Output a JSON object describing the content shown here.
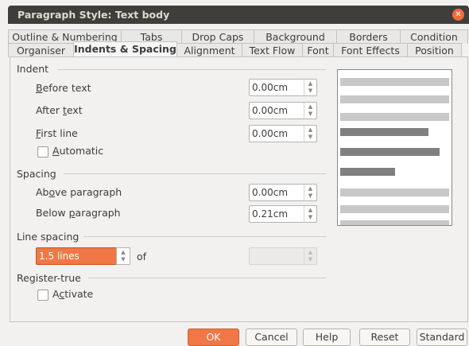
{
  "window": {
    "title": "Paragraph Style: Text body"
  },
  "tabs_row1": [
    "Outline & Numbering",
    "Tabs",
    "Drop Caps",
    "Background",
    "Borders",
    "Condition"
  ],
  "tabs_row2": [
    "Organiser",
    "Indents & Spacing",
    "Alignment",
    "Text Flow",
    "Font",
    "Font Effects",
    "Position"
  ],
  "active_tab": "Indents & Spacing",
  "indent": {
    "label": "Indent",
    "before_text": {
      "pre": "",
      "mnemonic": "B",
      "post": "efore text",
      "value": "0.00cm"
    },
    "after_text": {
      "pre": "After ",
      "mnemonic": "t",
      "post": "ext",
      "value": "0.00cm"
    },
    "first_line": {
      "pre": "",
      "mnemonic": "F",
      "post": "irst line",
      "value": "0.00cm"
    },
    "automatic": {
      "pre": "",
      "mnemonic": "A",
      "post": "utomatic",
      "checked": false
    }
  },
  "spacing": {
    "label": "Spacing",
    "above": {
      "pre": "Ab",
      "mnemonic": "o",
      "post": "ve paragraph",
      "value": "0.00cm"
    },
    "below": {
      "pre": "Below ",
      "mnemonic": "p",
      "post": "aragraph",
      "value": "0.21cm"
    }
  },
  "line_spacing": {
    "label": "Line spacing",
    "selected": "1.5 lines",
    "of_label": "of",
    "of_value": ""
  },
  "register_true": {
    "label": "Register-true",
    "activate": {
      "pre": "A",
      "mnemonic": "c",
      "post": "tivate",
      "checked": false
    }
  },
  "colors": {
    "accent": "#f07746",
    "preview_light": "#c8c8c8",
    "preview_dark": "#808080"
  },
  "buttons": {
    "ok": "OK",
    "cancel": "Cancel",
    "help": "Help",
    "reset": "Reset",
    "standard": "Standard"
  }
}
